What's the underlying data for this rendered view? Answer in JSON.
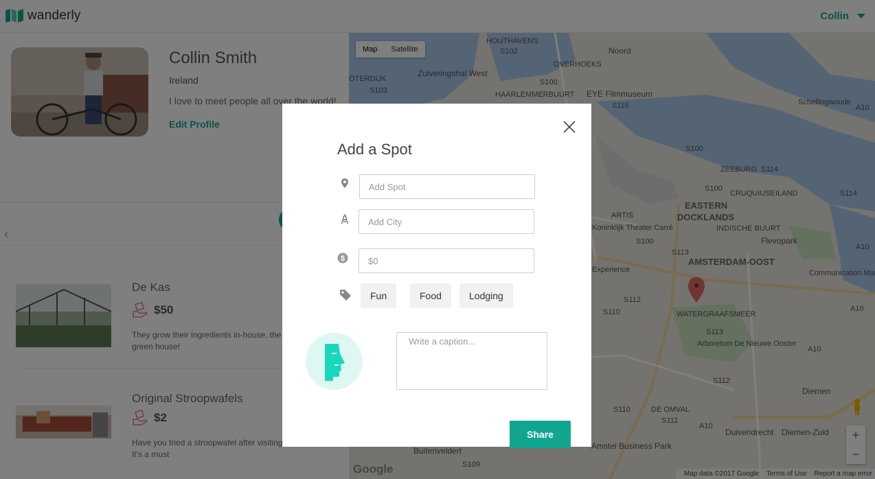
{
  "app": {
    "name": "wanderly"
  },
  "header": {
    "user_name": "Collin"
  },
  "profile": {
    "name": "Collin Smith",
    "country": "Ireland",
    "bio": "I love to meet people all over the world!",
    "edit_label": "Edit Profile"
  },
  "spots": [
    {
      "title": "De Kas",
      "price": "$50",
      "description": "They grow their ingredients in-house, the restaurant is a green house!"
    },
    {
      "title": "Original Stroopwafels",
      "price": "$2",
      "description": "Have you tried a stroopwafel after visiting a coffeeshop? It's a must"
    }
  ],
  "map": {
    "type_options": [
      "Map",
      "Satellite"
    ],
    "footer": [
      "Map data ©2017 Google",
      "Terms of Use",
      "Report a map error"
    ],
    "google_logo": "Google",
    "zoom_in": "+",
    "zoom_out": "−",
    "labels": [
      "HOUTHAVENS",
      "S102",
      "Noord",
      "Zuiveringshal West",
      "OVERHOEKS",
      "OTERDIJK",
      "S100",
      "HAARLEMMERBUURT",
      "EYE Filmmuseum",
      "S103",
      "S116",
      "Schellingwoude",
      "S100",
      "ZEEBURG",
      "S114",
      "CRUQUIUSEILAND",
      "S114",
      "S100",
      "ARTIS",
      "EASTERN",
      "DOCKLANDS",
      "INDISCHE BUURT",
      "Koninklijk Theater Carré",
      "S100",
      "Flevopark",
      "S113",
      "AMSTERDAM-OOST",
      "Experience",
      "Communication Marketing Amster",
      "WATERGRAAFSMEER",
      "S112",
      "S110",
      "S113",
      "Arboretum De Nieuwe Ooster",
      "A10",
      "S112",
      "Diemen",
      "S110",
      "DE OMVAL",
      "S111",
      "A10",
      "Duivendrecht",
      "Diemen-Zuid",
      "Amstel Business Park",
      "Buitenveldert",
      "S109",
      "A10",
      "A10",
      "A10"
    ]
  },
  "modal": {
    "title": "Add a Spot",
    "spot_placeholder": "Add Spot",
    "city_placeholder": "Add City",
    "price_placeholder": "$0",
    "tags": [
      "Fun",
      "Food",
      "Lodging"
    ],
    "caption_placeholder": "Write a caption...",
    "share_label": "Share"
  },
  "colors": {
    "accent": "#11a690",
    "upload_bg": "#dff7f3",
    "map_water": "#a8c8e8",
    "map_land": "#e8e6df"
  }
}
